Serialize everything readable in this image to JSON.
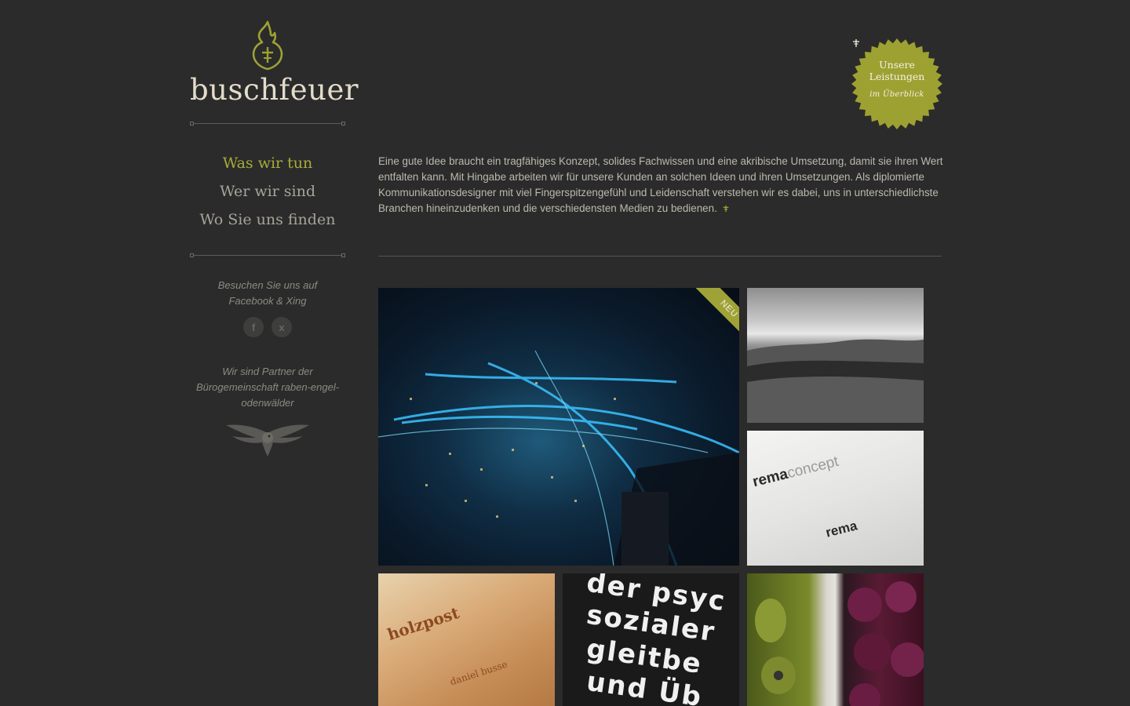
{
  "brand": {
    "name": "buschfeuer"
  },
  "nav": {
    "items": [
      {
        "label": "Was wir tun",
        "active": true
      },
      {
        "label": "Wer wir sind",
        "active": false
      },
      {
        "label": "Wo Sie uns finden",
        "active": false
      }
    ]
  },
  "social": {
    "text_line1": "Besuchen Sie uns auf",
    "text_line2": "Facebook & Xing",
    "icons": [
      {
        "name": "facebook-icon",
        "glyph": "f"
      },
      {
        "name": "xing-icon",
        "glyph": "x"
      }
    ]
  },
  "partner": {
    "line1": "Wir sind Partner der",
    "line2": "Bürogemeinschaft raben-engel-",
    "line3": "odenwälder"
  },
  "badge": {
    "line1": "Unsere",
    "line2": "Leistungen",
    "sub": "im Überblick"
  },
  "intro": {
    "text": "Eine gute Idee braucht ein tragfähiges Konzept, solides Fachwissen und eine akribische Umsetzung, damit sie ihren Wert entfalten kann. Mit Hingabe arbeiten wir für unsere Kunden an solchen Ideen und ihren Umsetzungen. Als diplomierte Kommunikationsdesigner mit viel Fingerspitzengefühl und Leidenschaft verstehen wir es dabei, uns in unterschiedlichste Branchen hineinzudenken und die verschiedensten Medien zu bedienen."
  },
  "tiles": {
    "neu_label": "NEU",
    "rema": {
      "brand_bold": "rema",
      "brand_light": "concept"
    },
    "holz": {
      "logo": "holzpost",
      "person": "daniel busse"
    },
    "psych": {
      "lines": [
        "der psyc",
        "sozialer",
        "gleitbe",
        "und Üb"
      ]
    }
  },
  "colors": {
    "background": "#2b2b2b",
    "accent_green": "#a8ac37",
    "badge_green": "#9da132",
    "text_light": "#cfcbc0"
  }
}
